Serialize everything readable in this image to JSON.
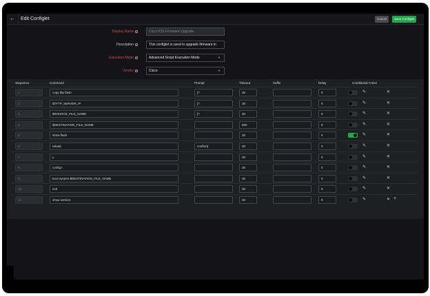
{
  "header": {
    "title": "Edit Configlet",
    "cancel": "Cancel",
    "save": "Save Configlet",
    "back_icon": "arrow-left-icon"
  },
  "form": {
    "display_name": {
      "label": "Display Name",
      "value": "Cisco IOS Firmware Upgrade",
      "required": true
    },
    "description": {
      "label": "Description",
      "value": "This configlet is used to upgrade firmware in"
    },
    "execution_mode": {
      "label": "Execution Mode",
      "value": "Advanced Script Execution Mode",
      "required": true
    },
    "vendor": {
      "label": "Vendor",
      "value": "Cisco",
      "required": true
    }
  },
  "table": {
    "headers": [
      "Sequence",
      "Command",
      "Prompt",
      "Timeout",
      "Suffix",
      "Delay",
      "Conditional Action"
    ],
    "rows": [
      {
        "seq": "1",
        "command": "copy tftp flash",
        "prompt": "]?",
        "timeout": "30",
        "suffix": "",
        "delay": "0",
        "conditional": false
      },
      {
        "seq": "2",
        "command": "$TFTP_SERVER_IP",
        "prompt": "]?",
        "timeout": "30",
        "suffix": "",
        "delay": "0",
        "conditional": false
      },
      {
        "seq": "3",
        "command": "$SOURCE_FILE_NAME",
        "prompt": "]?",
        "timeout": "30",
        "suffix": "",
        "delay": "0",
        "conditional": false
      },
      {
        "seq": "4",
        "command": "$DESTINATION_FILE_NAME",
        "prompt": "",
        "timeout": "500",
        "suffix": "",
        "delay": "0",
        "conditional": false
      },
      {
        "seq": "5",
        "command": "show flash",
        "prompt": "",
        "timeout": "30",
        "suffix": "",
        "delay": "0",
        "conditional": true
      },
      {
        "seq": "6",
        "command": "reload",
        "prompt": "confirm]",
        "timeout": "30",
        "suffix": "",
        "delay": "0",
        "conditional": false
      },
      {
        "seq": "7",
        "command": "y",
        "prompt": "",
        "timeout": "30",
        "suffix": "",
        "delay": "0",
        "conditional": false
      },
      {
        "seq": "8",
        "command": "config t",
        "prompt": "",
        "timeout": "30",
        "suffix": "",
        "delay": "0",
        "conditional": false
      },
      {
        "seq": "9",
        "command": "boot system $DESTINATION_FILE_NAME",
        "prompt": "",
        "timeout": "30",
        "suffix": "",
        "delay": "0",
        "conditional": false
      },
      {
        "seq": "10",
        "command": "exit",
        "prompt": "",
        "timeout": "30",
        "suffix": "",
        "delay": "0",
        "conditional": false
      },
      {
        "seq": "11",
        "command": "show version",
        "prompt": "",
        "timeout": "30",
        "suffix": "",
        "delay": "0",
        "conditional": false
      }
    ]
  },
  "colors": {
    "accent": "#1fa84a",
    "required": "#d04a4a"
  }
}
